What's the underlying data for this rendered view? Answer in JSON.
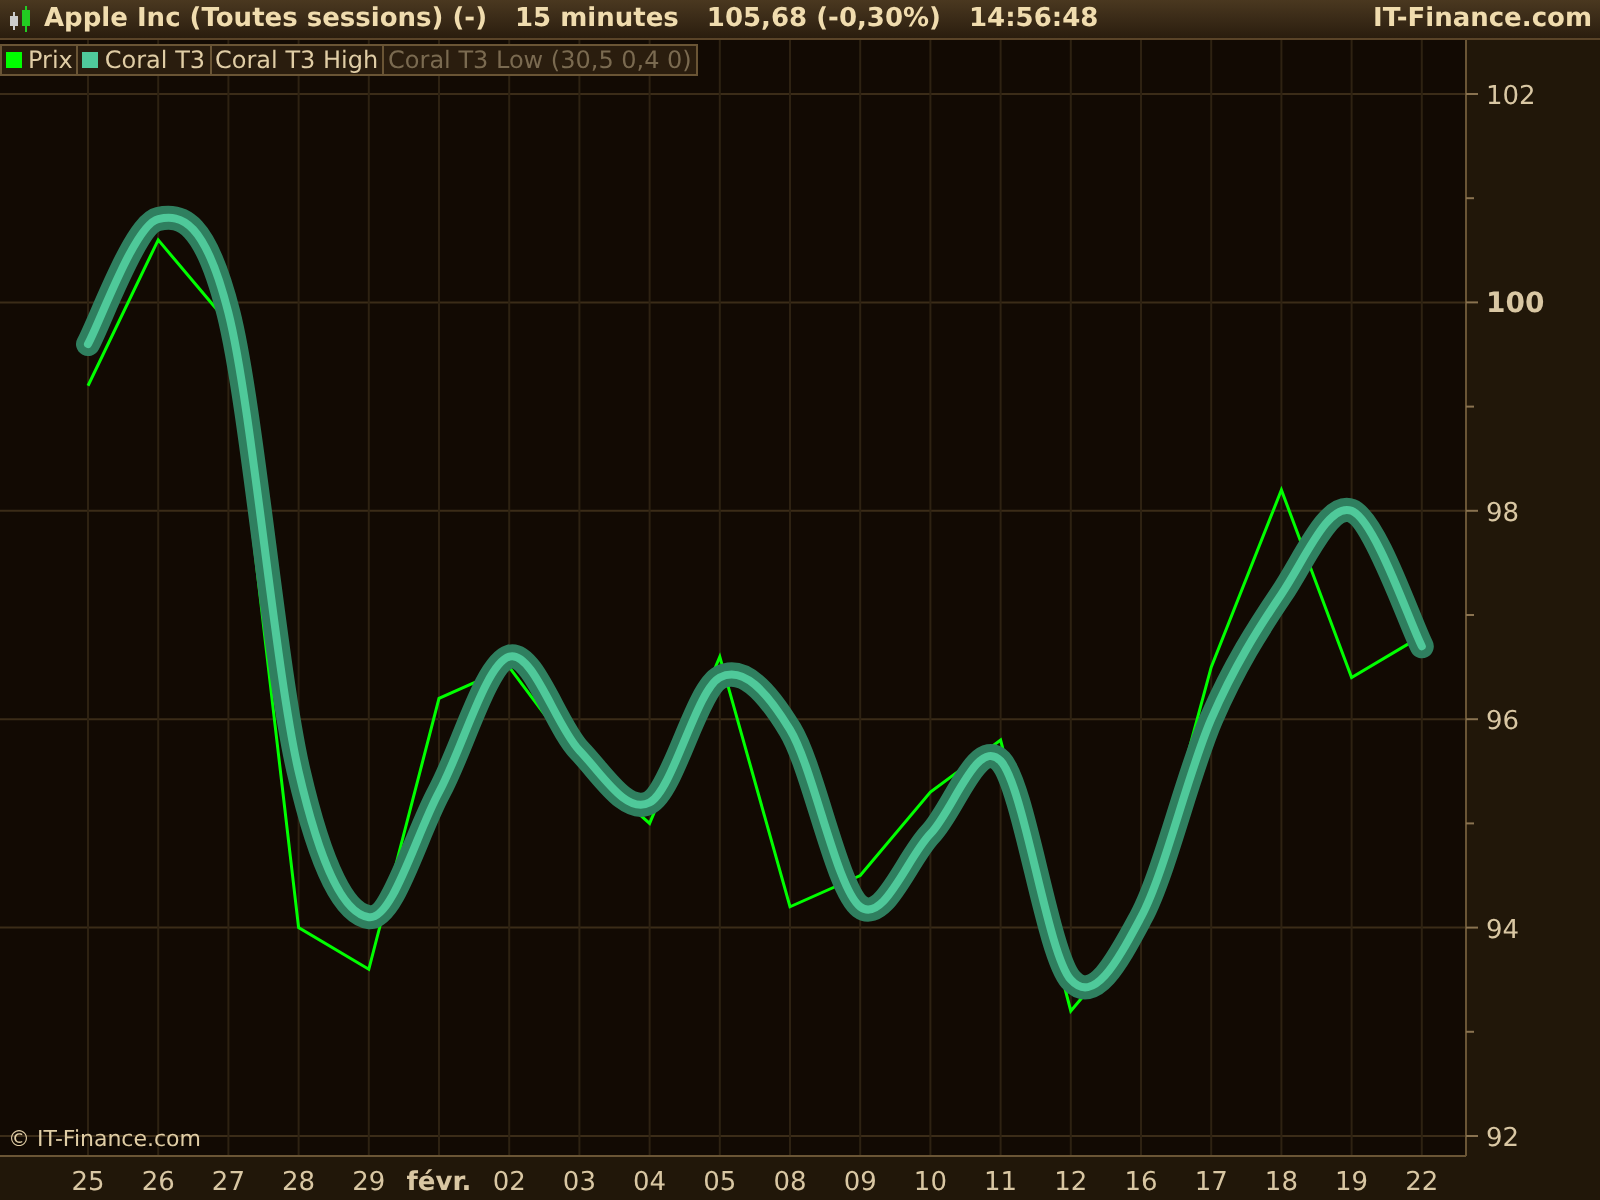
{
  "header": {
    "instrument": "Apple Inc (Toutes sessions) (-)",
    "interval": "15 minutes",
    "quote": "105,68 (-0,30%)",
    "time": "14:56:48",
    "brand": "IT-Finance.com"
  },
  "legend": [
    {
      "label": "Coral T3 High",
      "dimmed": false
    },
    {
      "label": "Coral T3 Low (30,5 0,4 0)",
      "dimmed": true
    }
  ],
  "copyright": "© IT-Finance.com",
  "chart_data": {
    "type": "line",
    "categories": [
      "25",
      "26",
      "27",
      "28",
      "29",
      "févr.",
      "02",
      "03",
      "04",
      "05",
      "08",
      "09",
      "10",
      "11",
      "12",
      "16",
      "17",
      "18",
      "19",
      "22"
    ],
    "series": [
      {
        "name": "Prix",
        "color": "#00ff00",
        "values": [
          99.2,
          100.6,
          99.8,
          94.0,
          93.6,
          96.2,
          96.5,
          95.6,
          95.0,
          96.6,
          94.2,
          94.5,
          95.3,
          95.8,
          93.2,
          94.0,
          96.5,
          98.2,
          96.4,
          96.8
        ]
      },
      {
        "name": "Coral T3",
        "color": "#4fc99a",
        "values": [
          99.6,
          100.8,
          99.9,
          95.5,
          94.1,
          95.3,
          96.6,
          95.7,
          95.2,
          96.4,
          95.9,
          94.2,
          94.9,
          95.6,
          93.5,
          94.1,
          96.0,
          97.2,
          98.0,
          96.7
        ]
      }
    ],
    "ylim": [
      92,
      102
    ],
    "grid": true,
    "legend": "top-left",
    "yticks": [
      92,
      94,
      96,
      98,
      100,
      102
    ]
  }
}
